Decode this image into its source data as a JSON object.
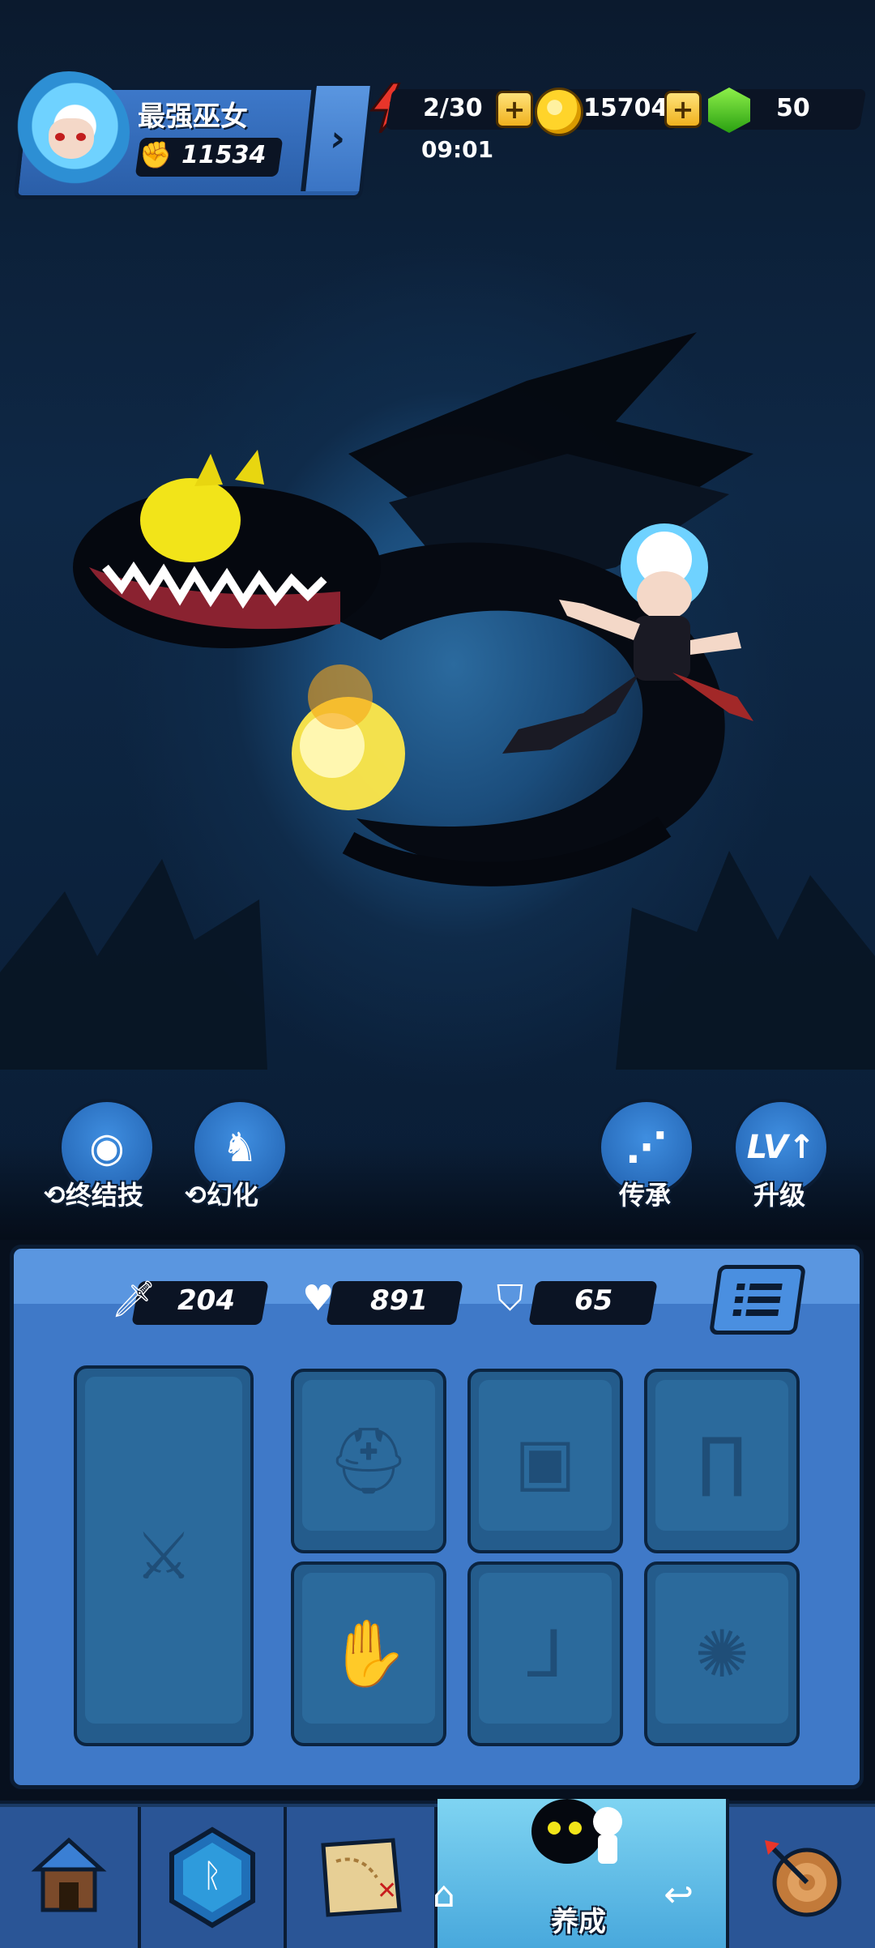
{
  "profile": {
    "name": "最强巫女",
    "power": "11534"
  },
  "currency": {
    "energy": "2/30",
    "energy_timer": "09:01",
    "coins": "15704",
    "gems": "50"
  },
  "skills": {
    "ultimate_label": "终结技",
    "transform_label": "幻化",
    "inherit_label": "传承",
    "upgrade_label": "升级",
    "upgrade_icon_text": "LV"
  },
  "stats": {
    "attack": "204",
    "health": "891",
    "defense": "65"
  },
  "equipment_slots": [
    "weapon",
    "helmet",
    "armor",
    "pants",
    "gloves",
    "boots",
    "accessory"
  ],
  "bottom_nav": {
    "active_label": "养成"
  }
}
